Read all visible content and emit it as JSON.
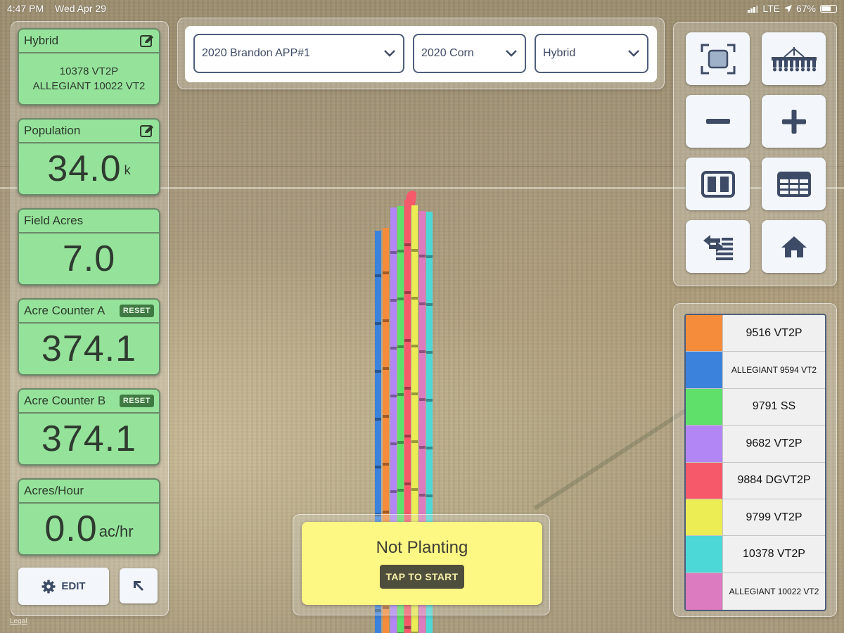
{
  "status_bar": {
    "time": "4:47 PM",
    "date": "Wed Apr 29",
    "network": "LTE",
    "battery": "67%",
    "battery_level": 0.67
  },
  "cards": {
    "hybrid": {
      "title": "Hybrid",
      "line1": "10378 VT2P",
      "line2": "ALLEGIANT 10022 VT2"
    },
    "population": {
      "title": "Population",
      "value": "34.0",
      "unit": "k"
    },
    "field_acres": {
      "title": "Field Acres",
      "value": "7.0"
    },
    "acre_counter_a": {
      "title": "Acre Counter A",
      "value": "374.1",
      "reset_label": "RESET"
    },
    "acre_counter_b": {
      "title": "Acre Counter B",
      "value": "374.1",
      "reset_label": "RESET"
    },
    "acres_hour": {
      "title": "Acres/Hour",
      "value": "0.0",
      "unit": "ac/hr"
    }
  },
  "buttons": {
    "edit_label": "EDIT"
  },
  "legal": "Legal",
  "dropdowns": {
    "field": "2020 Brandon APP#1",
    "season": "2020 Corn",
    "layer": "Hybrid"
  },
  "planting": {
    "status": "Not Planting",
    "start_label": "TAP TO START"
  },
  "legend": [
    {
      "color": "#f58c3c",
      "label": "9516 VT2P"
    },
    {
      "color": "#3b82dd",
      "label": "ALLEGIANT 9594 VT2"
    },
    {
      "color": "#5ee06a",
      "label": "9791 SS"
    },
    {
      "color": "#b287f5",
      "label": "9682 VT2P"
    },
    {
      "color": "#f5596a",
      "label": "9884 DGVT2P"
    },
    {
      "color": "#ecec54",
      "label": "9799 VT2P"
    },
    {
      "color": "#4dd8d8",
      "label": "10378 VT2P"
    },
    {
      "color": "#dc7bc0",
      "label": "ALLEGIANT 10022 VT2"
    }
  ]
}
